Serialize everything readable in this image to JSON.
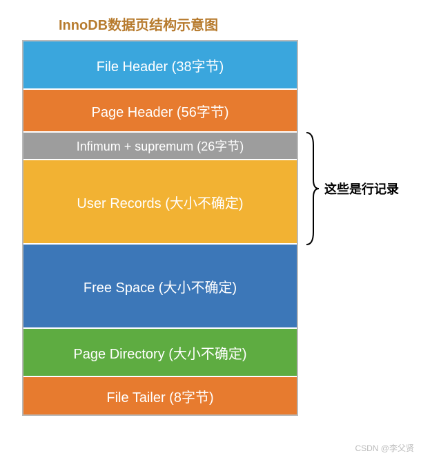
{
  "title": "InnoDB数据页结构示意图",
  "blocks": {
    "file_header": "File Header (38字节)",
    "page_header": "Page Header (56字节)",
    "infimum": "Infimum + supremum (26字节)",
    "user_records": "User Records (大小不确定)",
    "free_space": "Free Space (大小不确定)",
    "page_directory": "Page Directory (大小不确定)",
    "file_tailer": "File Tailer (8字节)"
  },
  "annotation": "这些是行记录",
  "watermark": "CSDN @李父贤"
}
